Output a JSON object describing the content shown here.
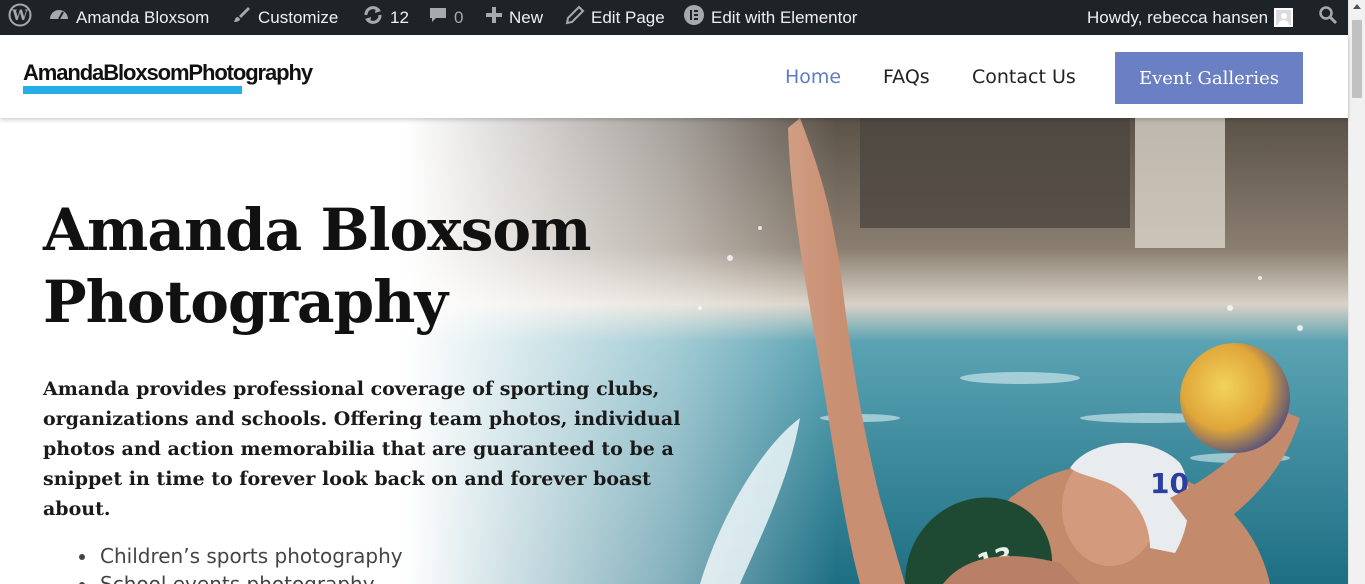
{
  "admin_bar": {
    "site_name": "Amanda Bloxsom",
    "customize": "Customize",
    "updates_count": "12",
    "comments_count": "0",
    "new_label": "New",
    "edit_page": "Edit Page",
    "edit_elementor": "Edit with Elementor",
    "howdy": "Howdy, rebecca hansen"
  },
  "header": {
    "logo_text": "AmandaBloxsomPhotography",
    "nav": [
      {
        "label": "Home",
        "active": true
      },
      {
        "label": "FAQs",
        "active": false
      },
      {
        "label": "Contact Us",
        "active": false
      }
    ],
    "cta_label": "Event Galleries"
  },
  "hero": {
    "title": "Amanda Bloxsom Photography",
    "description": "Amanda provides professional coverage of sporting clubs, organizations and schools. Offering team photos, individual photos and action memorabilia that are guaranteed to be a snippet in time to forever look back on and forever boast about.",
    "services": [
      "Children’s sports photography",
      "School events photography"
    ]
  },
  "colors": {
    "admin_bar_bg": "#1d2327",
    "nav_active": "#5e7cc2",
    "cta_bg": "#6a7fc4",
    "logo_underline": "#27aee6"
  },
  "icons": {
    "wordpress": "wordpress-logo-icon",
    "dashboard": "dashboard-icon",
    "customize": "paintbrush-icon",
    "updates": "refresh-icon",
    "comments": "comment-bubble-icon",
    "new": "plus-icon",
    "edit": "pencil-icon",
    "elementor": "elementor-icon",
    "search": "search-icon"
  }
}
